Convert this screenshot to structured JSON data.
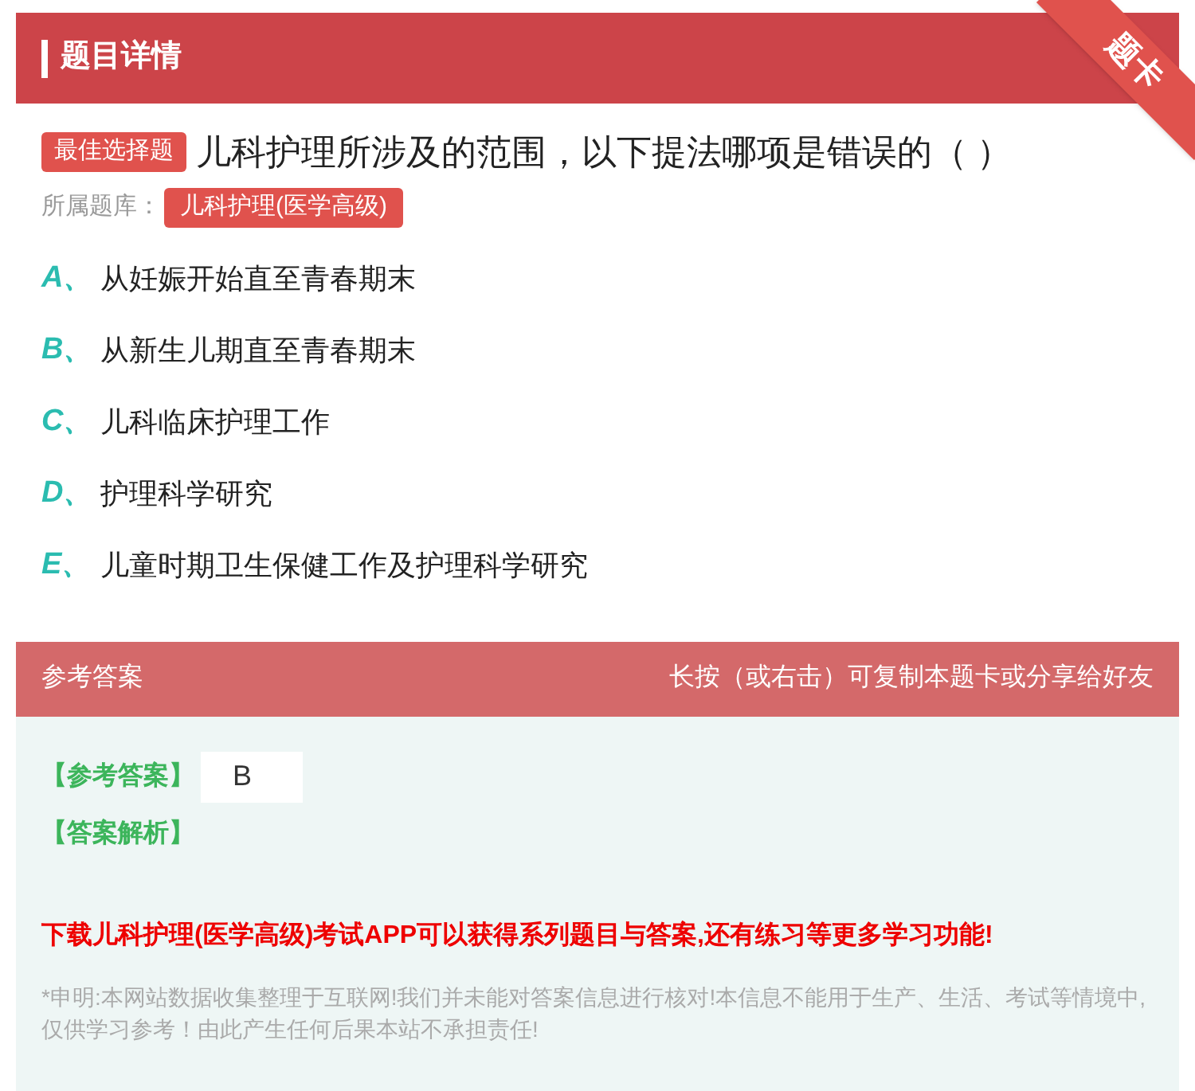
{
  "header": {
    "title": "题目详情",
    "ribbon": "题卡"
  },
  "question": {
    "type_tag": "最佳选择题",
    "text": "儿科护理所涉及的范围，以下提法哪项是错误的（ ）",
    "bank_label": "所属题库：",
    "bank": "儿科护理(医学高级)"
  },
  "options": [
    {
      "letter": "A、",
      "text": "从妊娠开始直至青春期末"
    },
    {
      "letter": "B、",
      "text": "从新生儿期直至青春期末"
    },
    {
      "letter": "C、",
      "text": "儿科临床护理工作"
    },
    {
      "letter": "D、",
      "text": "护理科学研究"
    },
    {
      "letter": "E、",
      "text": "儿童时期卫生保健工作及护理科学研究"
    }
  ],
  "answer_section": {
    "title": "参考答案",
    "hint": "长按（或右击）可复制本题卡或分享给好友",
    "answer_label": "【参考答案】",
    "answer": "B",
    "analysis_label": "【答案解析】",
    "promo": "下载儿科护理(医学高级)考试APP可以获得系列题目与答案,还有练习等更多学习功能!",
    "disclaimer": "*申明:本网站数据收集整理于互联网!我们并未能对答案信息进行核对!本信息不能用于生产、生活、考试等情境中,仅供学习参考！由此产生任何后果本站不承担责任!"
  }
}
